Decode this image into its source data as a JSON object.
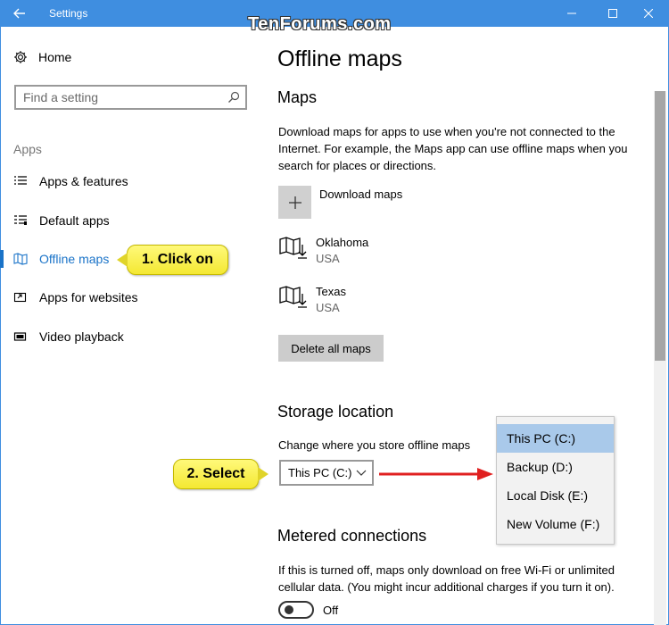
{
  "window": {
    "title": "Settings",
    "watermark": "TenForums.com",
    "accent": "#3f8ee0"
  },
  "sidebar": {
    "home_label": "Home",
    "search_placeholder": "Find a setting",
    "section_label": "Apps",
    "items": [
      {
        "label": "Apps & features",
        "icon": "list-icon"
      },
      {
        "label": "Default apps",
        "icon": "default-apps-icon"
      },
      {
        "label": "Offline maps",
        "icon": "map-icon",
        "active": true
      },
      {
        "label": "Apps for websites",
        "icon": "link-window-icon"
      },
      {
        "label": "Video playback",
        "icon": "video-icon"
      }
    ]
  },
  "callouts": {
    "step1": "1. Click on",
    "step2": "2. Select"
  },
  "main": {
    "title": "Offline maps",
    "maps_heading": "Maps",
    "maps_description": "Download maps for apps to use when you're not connected to the Internet. For example, the Maps app can use offline maps when you search for places or directions.",
    "download_label": "Download maps",
    "downloaded_maps": [
      {
        "name": "Oklahoma",
        "country": "USA"
      },
      {
        "name": "Texas",
        "country": "USA"
      }
    ],
    "delete_button": "Delete all maps",
    "storage_heading": "Storage location",
    "storage_description": "Change where you store offline maps",
    "storage_selected": "This PC (C:)",
    "storage_options": [
      "This PC (C:)",
      "Backup (D:)",
      "Local Disk (E:)",
      "New Volume (F:)"
    ],
    "metered_heading": "Metered connections",
    "metered_description": "If this is turned off, maps only download on free Wi-Fi or unlimited cellular data. (You might incur additional charges if you turn it on).",
    "metered_toggle_state": "Off"
  }
}
